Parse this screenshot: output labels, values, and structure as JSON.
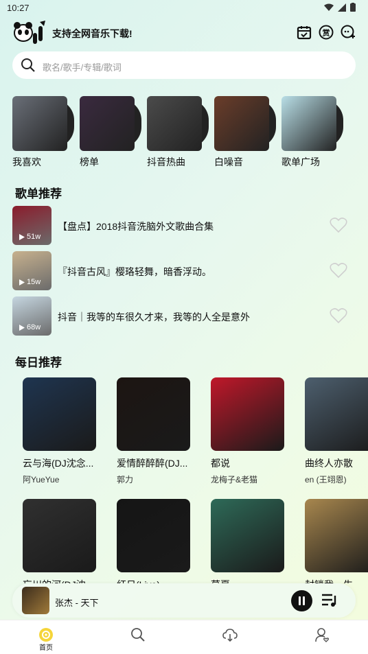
{
  "status": {
    "time": "10:27"
  },
  "header": {
    "slogan": "支持全网音乐下载!"
  },
  "search": {
    "placeholder": "歌名/歌手/专辑/歌词"
  },
  "quick_links": [
    {
      "label": "我喜欢",
      "color": "#6a6f78"
    },
    {
      "label": "榜单",
      "color": "#3a2a3f"
    },
    {
      "label": "抖音热曲",
      "color": "#4b4b4b"
    },
    {
      "label": "白噪音",
      "color": "#6b3d2a"
    },
    {
      "label": "歌单广场",
      "color": "#b9dfe7"
    }
  ],
  "playlists_section": {
    "title": "歌单推荐"
  },
  "playlists": [
    {
      "title": "【盘点】2018抖音洗脑外文歌曲合集",
      "plays": "51w",
      "color": "#8b1c2c"
    },
    {
      "title": "『抖音古风』樱珞轻舞，暗香浮动。",
      "plays": "15w",
      "color": "#c7b18e"
    },
    {
      "title": "抖音｜我等的车很久才来，我等的人全是意外",
      "plays": "68w",
      "color": "#c5d6e0"
    }
  ],
  "daily_section": {
    "title": "每日推荐"
  },
  "daily": [
    {
      "title": "云与海(DJ沈念...",
      "artist": "阿YueYue",
      "color": "#1f3550"
    },
    {
      "title": "爱情醉醉醉(DJ...",
      "artist": "郭力",
      "color": "#1c1512"
    },
    {
      "title": "都说",
      "artist": "龙梅子&老猫",
      "color": "#c0182a"
    },
    {
      "title": "曲终人亦散",
      "artist": "en (王翊恩)",
      "color": "#4d5f6e"
    },
    {
      "title": "忘川的河(DJ沈",
      "artist": "",
      "color": "#303030"
    },
    {
      "title": "红日(Live)",
      "artist": "",
      "color": "#151515"
    },
    {
      "title": "莫夏",
      "artist": "",
      "color": "#2e6a58"
    },
    {
      "title": "封锁我一生",
      "artist": "",
      "color": "#a8874e"
    }
  ],
  "player": {
    "now_playing": "张杰 - 天下"
  },
  "tabs": [
    {
      "label": "首页",
      "icon": "home-icon",
      "active": true
    },
    {
      "label": "",
      "icon": "search-icon"
    },
    {
      "label": "",
      "icon": "cloud-download-icon"
    },
    {
      "label": "",
      "icon": "profile-icon"
    }
  ],
  "colors": {
    "accent": "#f5d53a",
    "text": "#111111",
    "muted": "#999999"
  }
}
